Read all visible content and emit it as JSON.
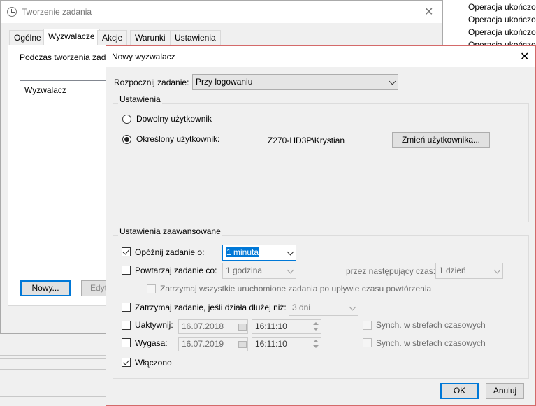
{
  "background_list": [
    "Operacja ukończo",
    "Operacja ukończo",
    "Operacja ukończo",
    "Operacja ukończo"
  ],
  "parent": {
    "title": "Tworzenie zadania",
    "tabs": [
      "Ogólne",
      "Wyzwalacze",
      "Akcje",
      "Warunki",
      "Ustawienia"
    ],
    "selected_tab": "Wyzwalacze",
    "intro": "Podczas tworzenia zada",
    "list_header": "Wyzwalacz",
    "new_button": "Nowy...",
    "edit_button": "Edyt"
  },
  "dialog": {
    "title": "Nowy wyzwalacz",
    "start_label": "Rozpocznij zadanie:",
    "start_value": "Przy logowaniu",
    "settings_group": "Ustawienia",
    "any_user": "Dowolny użytkownik",
    "specific_user": "Określony użytkownik:",
    "user_name": "Z270-HD3P\\Krystian",
    "change_user_button": "Zmień użytkownika...",
    "advanced_group": "Ustawienia zaawansowane",
    "delay_label": "Opóźnij zadanie o:",
    "delay_value": "1 minuta",
    "repeat_label": "Powtarzaj zadanie co:",
    "repeat_value": "1 godzina",
    "duration_label": "przez następujący czas:",
    "duration_value": "1 dzień",
    "stop_all_label": "Zatrzymaj wszystkie uruchomione zadania po upływie czasu powtórzenia",
    "stop_longer_label": "Zatrzymaj zadanie, jeśli działa dłużej niż:",
    "stop_longer_value": "3 dni",
    "activate_label": "Uaktywnij:",
    "activate_date": "16.07.2018",
    "activate_time": "16:11:10",
    "expire_label": "Wygasa:",
    "expire_date": "16.07.2019",
    "expire_time": "16:11:10",
    "sync_label": "Synch. w strefach czasowych",
    "enabled_label": "Włączono",
    "ok_button": "OK",
    "cancel_button": "Anuluj"
  }
}
